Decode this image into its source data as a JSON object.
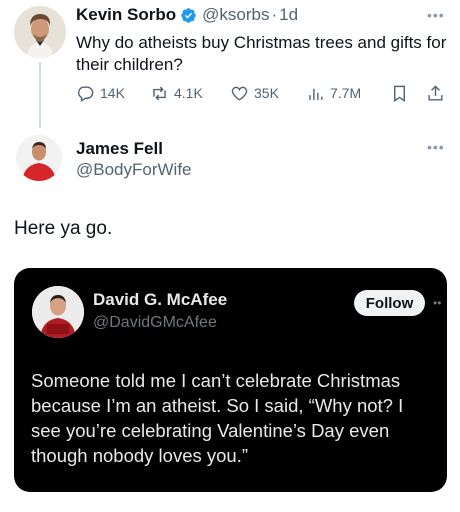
{
  "tweet": {
    "author_name": "Kevin Sorbo",
    "author_handle": "@ksorbs",
    "dot": "·",
    "time": "1d",
    "text": "Why do atheists buy Christmas trees and gifts for their children?",
    "stats": {
      "replies": "14K",
      "retweets": "4.1K",
      "likes": "35K",
      "views": "7.7M"
    },
    "icons": [
      "verified-badge-icon",
      "reply-icon",
      "retweet-icon",
      "like-icon",
      "views-icon",
      "bookmark-icon",
      "share-icon",
      "more-icon"
    ]
  },
  "reply": {
    "author_name": "James Fell",
    "author_handle": "@BodyForWife",
    "text": "Here ya go."
  },
  "quoted": {
    "author_name": "David G. McAfee",
    "author_handle": "@DavidGMcAfee",
    "follow_label": "Follow",
    "text": "Someone told me I can’t celebrate Christmas because I’m an atheist. So I said, “Why not? I see you’re celebrating Valentine’s Day even though nobody loves you.”"
  },
  "colors": {
    "verified": "#1d9bf0",
    "secondary_text": "#536471",
    "card_bg": "#000000",
    "card_text": "#e7e9ea"
  }
}
